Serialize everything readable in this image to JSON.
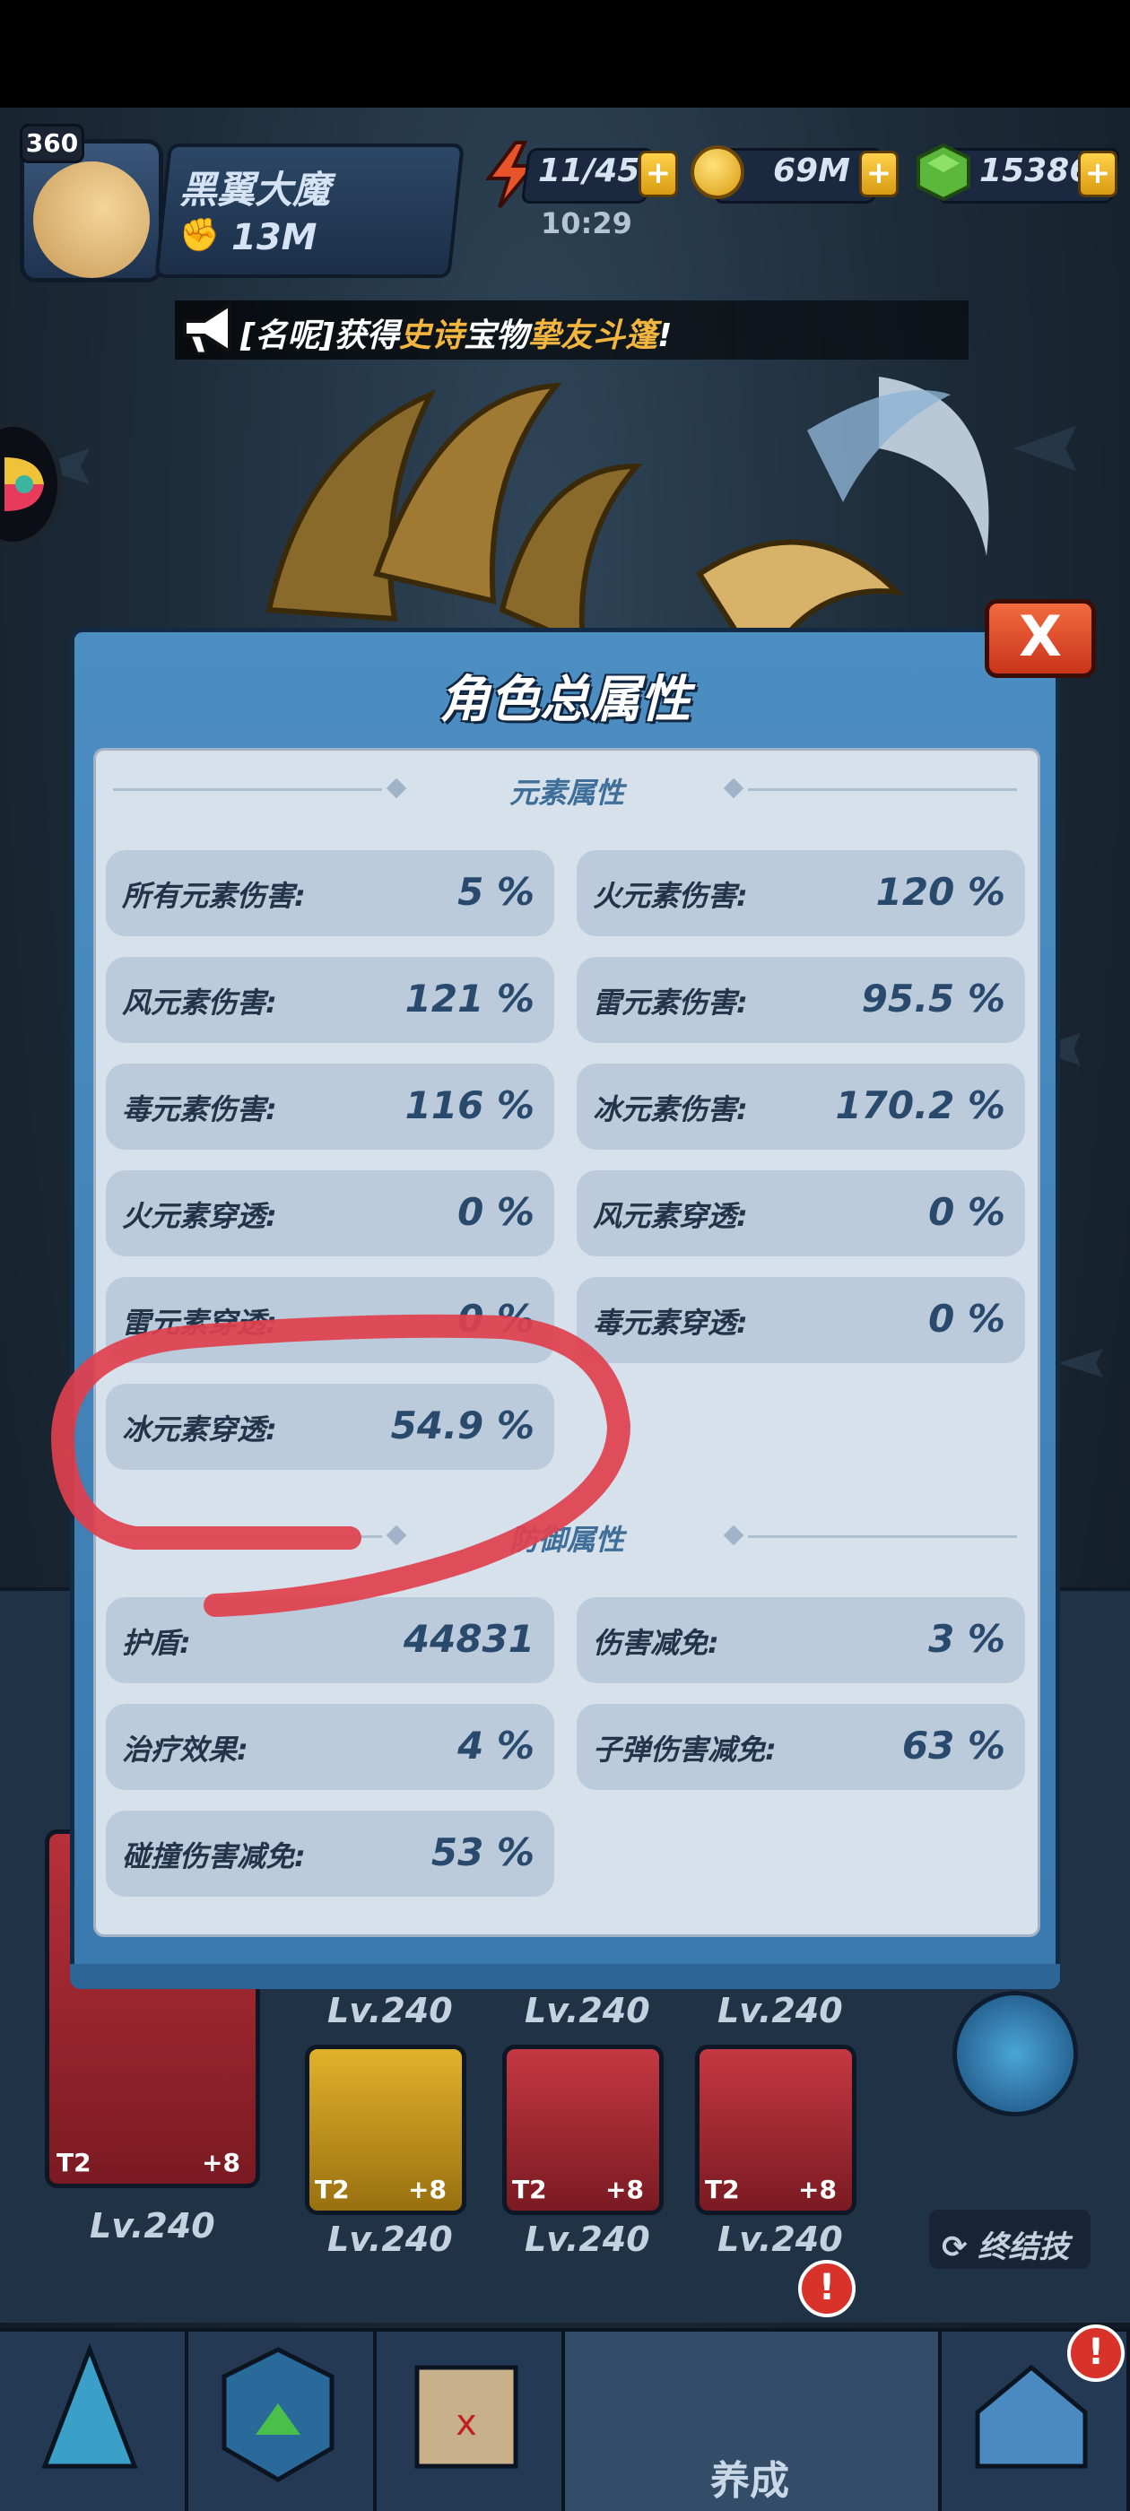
{
  "player": {
    "level": "360",
    "name": "黑翼大魔",
    "power": "13M"
  },
  "resources": {
    "energy": "11/45",
    "energy_timer": "10:29",
    "coins": "69M",
    "gems": "15386",
    "plus": "+"
  },
  "broadcast": {
    "prefix": "[名呢]获得",
    "rarity": "史诗",
    "middle": "宝物",
    "item": "挚友斗篷",
    "suffix": "!"
  },
  "modal": {
    "title": "角色总属性",
    "close_label": "X",
    "sections": {
      "element": {
        "title": "元素属性",
        "stats": [
          {
            "label": "所有元素伤害:",
            "value": "5 %"
          },
          {
            "label": "火元素伤害:",
            "value": "120 %"
          },
          {
            "label": "风元素伤害:",
            "value": "121 %"
          },
          {
            "label": "雷元素伤害:",
            "value": "95.5 %"
          },
          {
            "label": "毒元素伤害:",
            "value": "116 %"
          },
          {
            "label": "冰元素伤害:",
            "value": "170.2 %"
          },
          {
            "label": "火元素穿透:",
            "value": "0 %"
          },
          {
            "label": "风元素穿透:",
            "value": "0 %"
          },
          {
            "label": "雷元素穿透:",
            "value": "0 %"
          },
          {
            "label": "毒元素穿透:",
            "value": "0 %"
          },
          {
            "label": "冰元素穿透:",
            "value": "54.9 %"
          }
        ]
      },
      "defense": {
        "title": "防御属性",
        "stats": [
          {
            "label": "护盾:",
            "value": "44831"
          },
          {
            "label": "伤害减免:",
            "value": "3 %"
          },
          {
            "label": "治疗效果:",
            "value": "4 %"
          },
          {
            "label": "子弹伤害减免:",
            "value": "63 %"
          },
          {
            "label": "碰撞伤害减免:",
            "value": "53 %"
          }
        ]
      }
    }
  },
  "equipment": {
    "cards": [
      {
        "tier": "T2",
        "plus": "+8",
        "level": "Lv.240"
      },
      {
        "tier": "T2",
        "plus": "+8",
        "level": "Lv.240"
      },
      {
        "tier": "T2",
        "plus": "+8",
        "level": "Lv.240"
      },
      {
        "tier": "T2",
        "plus": "+8",
        "level": "Lv.240"
      }
    ],
    "top_row_levels": [
      "Lv.240",
      "Lv.240",
      "Lv.240"
    ],
    "finisher_label": "终结技"
  },
  "bottom_nav": {
    "active_label": "养成",
    "alert": "!"
  },
  "colors": {
    "modal_blue": "#4d8ec2",
    "panel_bg": "#d7e1ec",
    "stat_bg": "#bccbdb",
    "close_red": "#e04a2a",
    "gold_text": "#f2b640",
    "annotation_red": "#e0404e"
  },
  "icons": [
    "energy-bolt-icon",
    "coin-icon",
    "gem-icon",
    "megaphone-icon",
    "close-icon",
    "power-fist-icon",
    "castle-icon",
    "sync-icon"
  ]
}
